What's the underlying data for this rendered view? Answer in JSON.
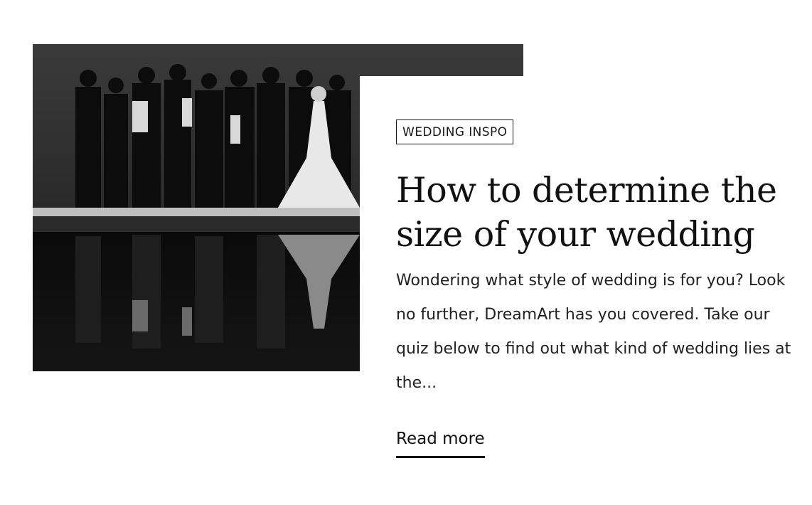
{
  "post": {
    "category_tag": "WEDDING INSPO",
    "title": "How to determine the size of your wedding",
    "excerpt": "Wondering what style of wedding is for you? Look no further, DreamArt has you covered. Take our quiz below to find out what kind of wedding lies at the...",
    "read_more_label": "Read more",
    "image_icon": "wedding-party-photo"
  },
  "colors": {
    "text": "#111111",
    "background": "#ffffff",
    "photo_dark": "#0e0e0e"
  }
}
